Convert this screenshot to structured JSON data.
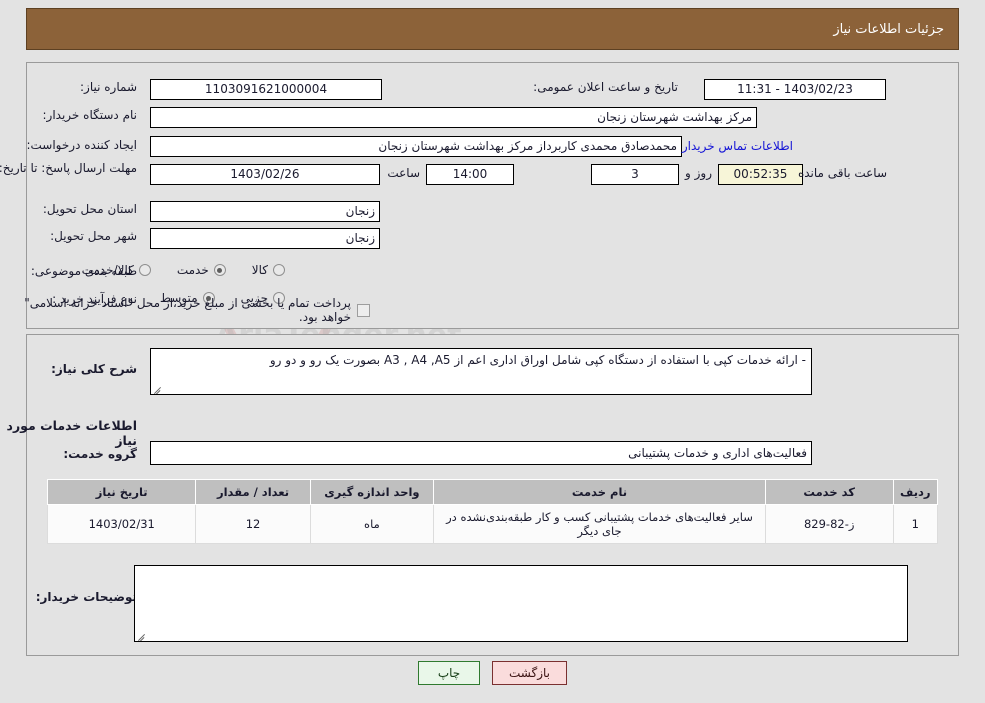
{
  "header": {
    "title": "جزئیات اطلاعات نیاز"
  },
  "form": {
    "need_number_label": "شماره نیاز:",
    "need_number_value": "1103091621000004",
    "announce_datetime_label": "تاریخ و ساعت اعلان عمومی:",
    "announce_datetime_value": "1403/02/23 - 11:31",
    "buyer_org_label": "نام دستگاه خریدار:",
    "buyer_org_value": "مرکز بهداشت شهرستان زنجان",
    "creator_label": "ایجاد کننده درخواست:",
    "creator_value": "محمدصادق محمدی کاربرداز مرکز بهداشت شهرستان زنجان",
    "contact_link": "اطلاعات تماس خریدار",
    "deadline_label": "مهلت ارسال پاسخ: تا تاریخ:",
    "deadline_date": "1403/02/26",
    "hour_label": "ساعت",
    "deadline_hour": "14:00",
    "days_value": "3",
    "days_label": "روز و",
    "countdown_value": "00:52:35",
    "countdown_label": "ساعت باقی مانده",
    "province_label": "استان محل تحویل:",
    "province_value": "زنجان",
    "city_label": "شهر محل تحویل:",
    "city_value": "زنجان",
    "category_label": "طبقه بندی موضوعی:",
    "category_options": [
      {
        "label": "کالا",
        "selected": false
      },
      {
        "label": "خدمت",
        "selected": true
      },
      {
        "label": "کالا/خدمت",
        "selected": false
      }
    ],
    "process_label": "نوع فرآیند خرید :",
    "process_options": [
      {
        "label": "جزیی",
        "selected": false
      },
      {
        "label": "متوسط",
        "selected": true
      }
    ],
    "treasury_checkbox_checked": false,
    "treasury_note": "پرداخت تمام یا بخشی از مبلغ خرید،از محل \"اسناد خزانه اسلامی\" خواهد بود."
  },
  "details": {
    "general_desc_label": "شرح کلی نیاز:",
    "general_desc_value": "-    ارائه خدمات کپی با استفاده از دستگاه کپی شامل اوراق اداری اعم از A3 , A4 ,A5 بصورت یک رو و دو رو",
    "services_section_title": "اطلاعات خدمات مورد نیاز",
    "service_group_label": "گروه خدمت:",
    "service_group_value": "فعالیت‌های اداری و خدمات پشتیبانی",
    "buyer_notes_label": "توضیحات خریدار:",
    "buyer_notes_value": ""
  },
  "table": {
    "columns": [
      "ردیف",
      "کد خدمت",
      "نام خدمت",
      "واحد اندازه گیری",
      "تعداد / مقدار",
      "تاریخ نیاز"
    ],
    "rows": [
      {
        "row_no": "1",
        "service_code": "ز-82-829",
        "service_name": "سایر فعالیت‌های خدمات پشتیبانی کسب و کار طبقه‌بندی‌نشده در جای دیگر",
        "unit": "ماه",
        "quantity": "12",
        "need_date": "1403/02/31"
      }
    ]
  },
  "buttons": {
    "back": "بازگشت",
    "print": "چاپ"
  },
  "watermark": {
    "brand_left": "Aria",
    "brand_right": "Tender",
    "brand_tld": ".net",
    "brand_top": "AriaTender.net"
  },
  "colors": {
    "header_bg": "#8c6239",
    "link": "#1414d6",
    "table_header_bg": "#bfbfbf",
    "countdown_bg": "#f7f5d8",
    "back_btn_bg": "#fadcdc",
    "print_btn_bg": "#e9f7e9",
    "page_bg": "#e3e3e3"
  }
}
